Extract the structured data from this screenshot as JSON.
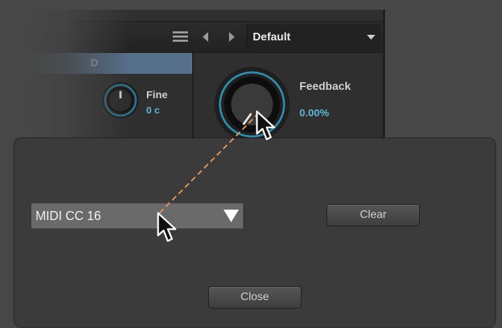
{
  "plugin": {
    "preset": {
      "name": "Default"
    },
    "section": {
      "header_letter": "D"
    },
    "fine": {
      "label": "Fine",
      "value": "0 c"
    },
    "feedback": {
      "label": "Feedback",
      "value": "0.00%"
    }
  },
  "dialog": {
    "midi_select": {
      "value": "MIDI CC 16"
    },
    "clear_label": "Clear",
    "close_label": "Close"
  },
  "colors": {
    "accent_blue": "#5fb6d6",
    "section_header": "#566f8a",
    "drag_line": "#e89a5c"
  },
  "icons": {
    "menu": "hamburger-icon",
    "prev": "arrow-left-icon",
    "next": "arrow-right-icon",
    "caret": "caret-down-icon",
    "cursor": "mouse-pointer-icon"
  }
}
